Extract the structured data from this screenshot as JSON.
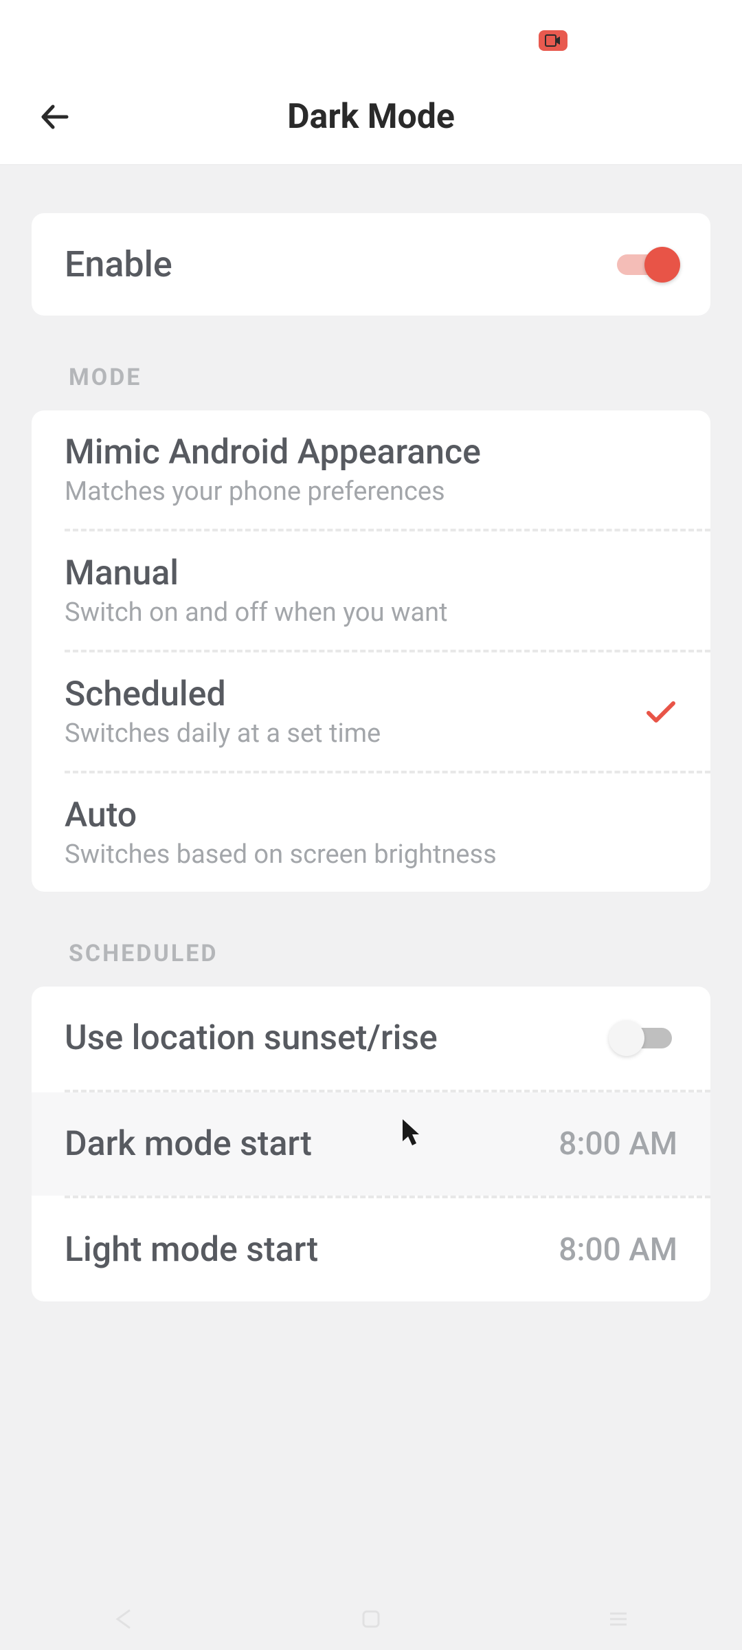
{
  "header": {
    "title": "Dark Mode"
  },
  "enable": {
    "label": "Enable",
    "on": true
  },
  "sections": {
    "mode": {
      "header": "MODE",
      "options": [
        {
          "title": "Mimic Android Appearance",
          "subtitle": "Matches your phone preferences",
          "selected": false
        },
        {
          "title": "Manual",
          "subtitle": "Switch on and off when you want",
          "selected": false
        },
        {
          "title": "Scheduled",
          "subtitle": "Switches daily at a set time",
          "selected": true
        },
        {
          "title": "Auto",
          "subtitle": "Switches based on screen brightness",
          "selected": false
        }
      ]
    },
    "scheduled": {
      "header": "SCHEDULED",
      "use_location": {
        "label": "Use location sunset/rise",
        "on": false
      },
      "dark_start": {
        "label": "Dark mode start",
        "value": "8:00 AM"
      },
      "light_start": {
        "label": "Light mode start",
        "value": "8:00 AM"
      }
    }
  },
  "colors": {
    "accent": "#e85447",
    "accent_light": "#f4bdb7"
  }
}
